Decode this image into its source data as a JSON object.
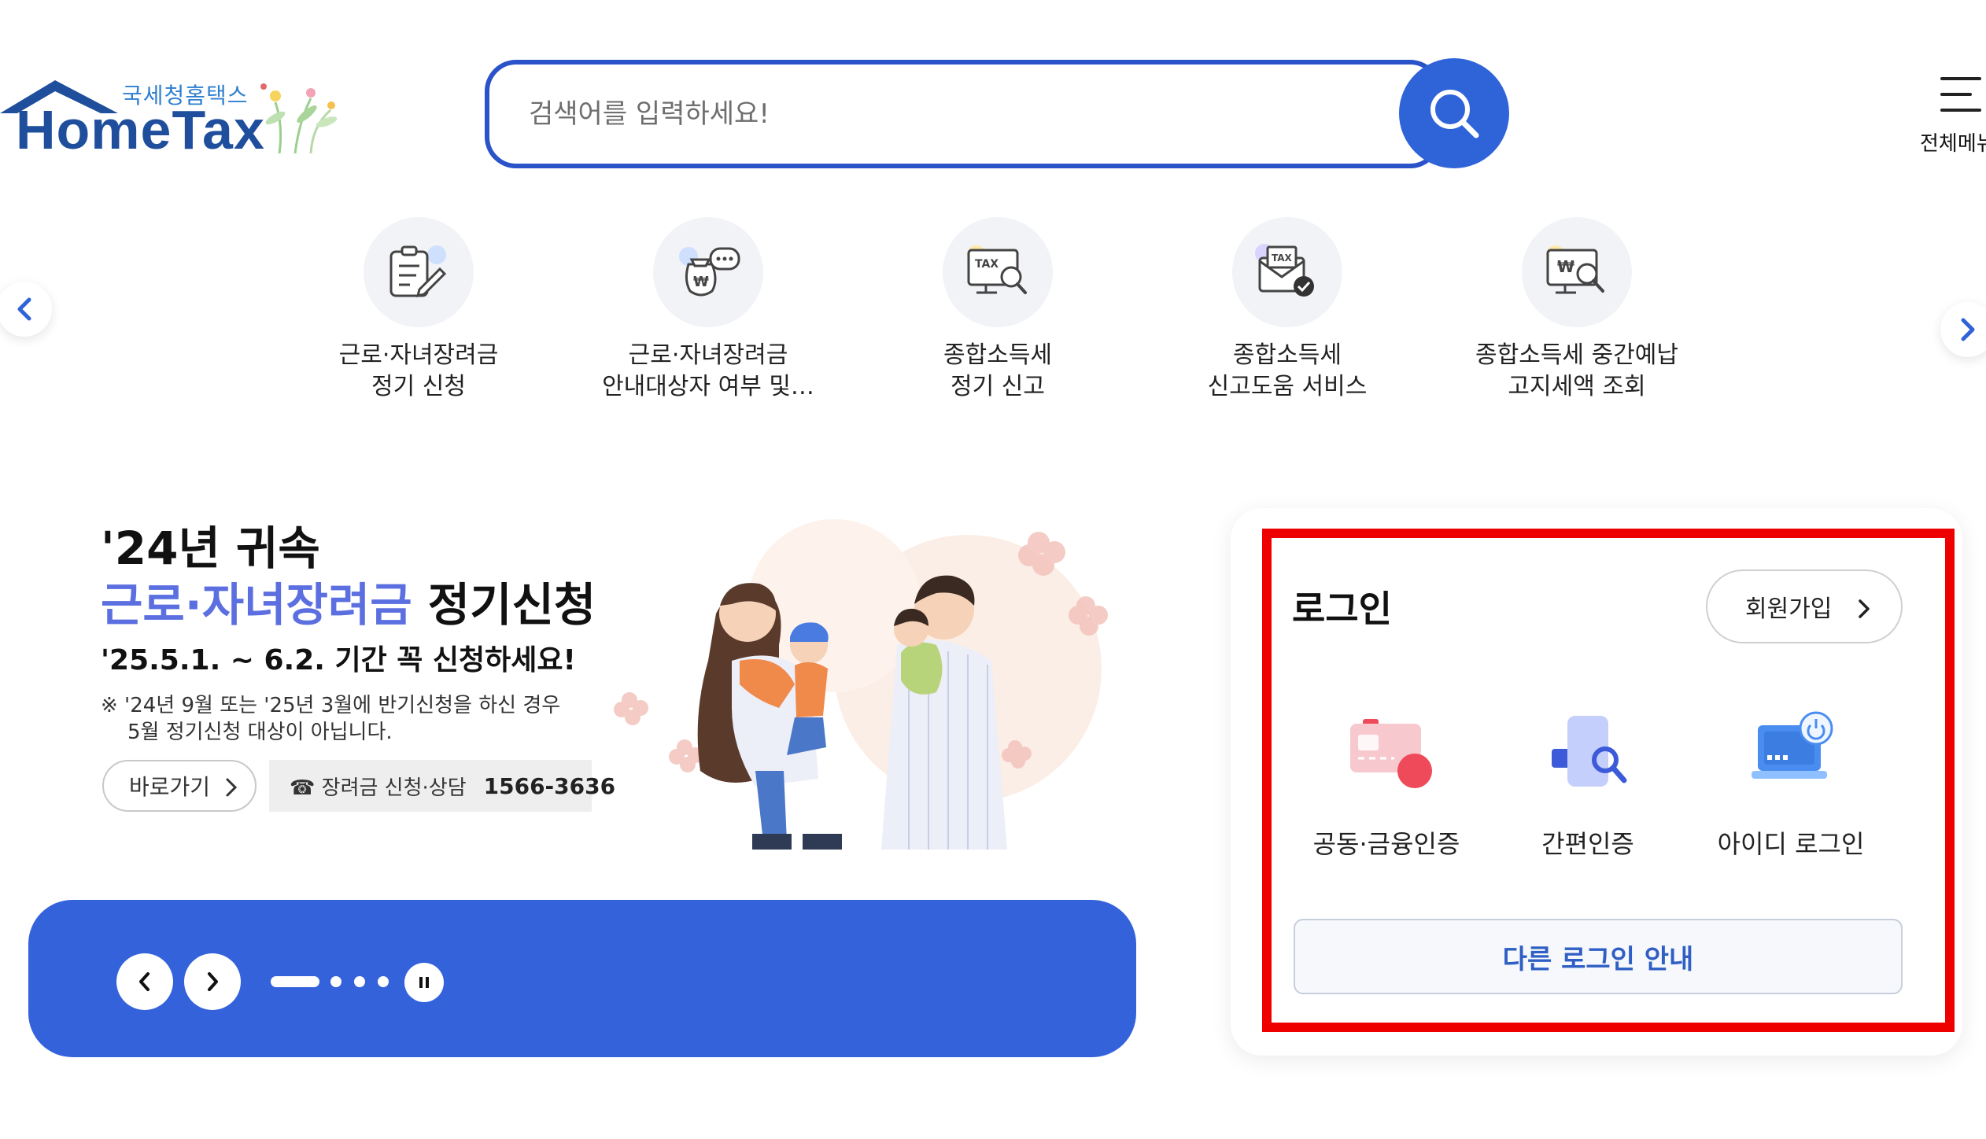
{
  "header": {
    "logo_sub": "국세청홈택스",
    "logo_main": "HomeTax",
    "search_placeholder": "검색어를 입력하세요!",
    "menu_label": "전체메뉴"
  },
  "quick_menu": [
    {
      "line1": "근로·자녀장려금",
      "line2": "정기 신청",
      "icon": "document-pen-icon"
    },
    {
      "line1": "근로·자녀장려금",
      "line2": "안내대상자 여부 및…",
      "icon": "money-bag-chat-icon"
    },
    {
      "line1": "종합소득세",
      "line2": "정기 신고",
      "icon": "tax-monitor-search-icon"
    },
    {
      "line1": "종합소득세",
      "line2": "신고도움 서비스",
      "icon": "tax-envelope-check-icon"
    },
    {
      "line1": "종합소득세 중간예납",
      "line2": "고지세액 조회",
      "icon": "won-monitor-search-icon"
    }
  ],
  "banner": {
    "title1": "'24년 귀속",
    "title2_highlight": "근로·자녀장려금",
    "title2_rest": " 정기신청",
    "period": "'25.5.1. ~ 6.2. 기간 꼭 신청하세요!",
    "note_line1": "※ '24년 9월 또는 '25년 3월에 반기신청을 하신 경우",
    "note_line2": "5월 정기신청 대상이 아닙니다.",
    "go_label": "바로가기",
    "phone_label": "☎ 장려금 신청·상담",
    "phone_number": "1566-3636"
  },
  "slider": {
    "total_slides": 4,
    "active_index": 0
  },
  "login": {
    "title": "로그인",
    "join_label": "회원가입",
    "options": [
      {
        "label": "공동·금융인증",
        "icon": "certificate-card-icon"
      },
      {
        "label": "간편인증",
        "icon": "simple-auth-phone-icon"
      },
      {
        "label": "아이디 로그인",
        "icon": "id-login-laptop-icon"
      }
    ],
    "other_label": "다른 로그인 안내",
    "highlight_color": "#ee0000"
  },
  "colors": {
    "brand_blue": "#2f63d8",
    "slider_blue": "#3362db",
    "highlight_text": "#5b6fe0"
  }
}
